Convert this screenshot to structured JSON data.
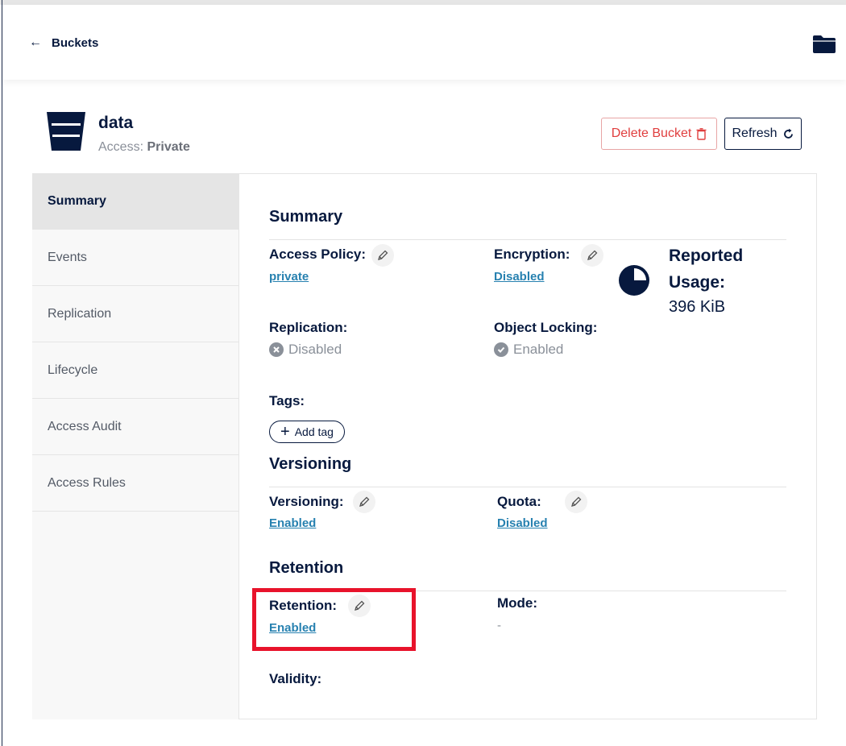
{
  "topbar": {
    "back_label": "Buckets"
  },
  "bucket": {
    "name": "data",
    "access_prefix": "Access:",
    "access_value": "Private"
  },
  "actions": {
    "delete_label": "Delete Bucket",
    "refresh_label": "Refresh"
  },
  "sidebar": {
    "items": [
      {
        "label": "Summary"
      },
      {
        "label": "Events"
      },
      {
        "label": "Replication"
      },
      {
        "label": "Lifecycle"
      },
      {
        "label": "Access Audit"
      },
      {
        "label": "Access Rules"
      }
    ]
  },
  "summary": {
    "title": "Summary",
    "access_policy_label": "Access Policy:",
    "access_policy_value": "private",
    "encryption_label": "Encryption:",
    "encryption_value": "Disabled",
    "reported_usage_label": "Reported Usage:",
    "reported_usage_value": "396 KiB",
    "replication_label": "Replication:",
    "replication_value": "Disabled",
    "object_locking_label": "Object Locking:",
    "object_locking_value": "Enabled",
    "tags_label": "Tags:",
    "add_tag_label": "Add tag"
  },
  "versioning": {
    "title": "Versioning",
    "versioning_label": "Versioning:",
    "versioning_value": "Enabled",
    "quota_label": "Quota:",
    "quota_value": "Disabled"
  },
  "retention": {
    "title": "Retention",
    "retention_label": "Retention:",
    "retention_value": "Enabled",
    "mode_label": "Mode:",
    "mode_value": "-",
    "validity_label": "Validity:"
  },
  "colors": {
    "navy": "#07193E",
    "link": "#2781b0",
    "danger": "#e03e3e",
    "highlight": "#e8132b"
  }
}
